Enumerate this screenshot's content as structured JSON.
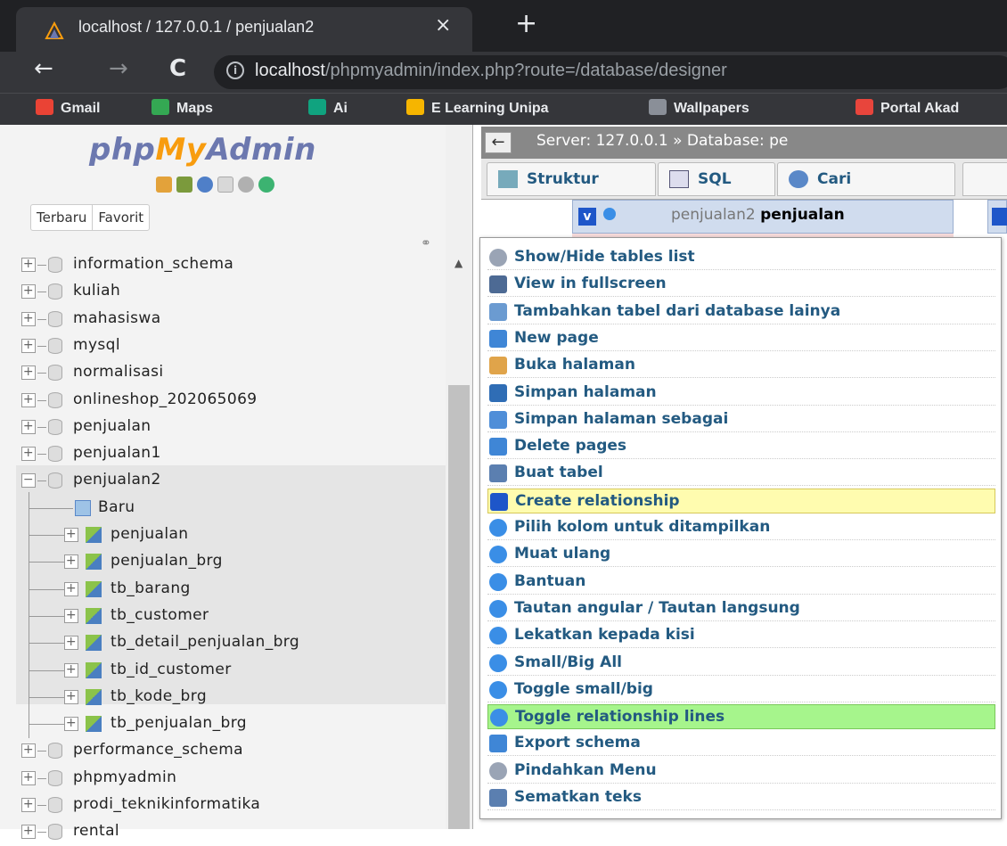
{
  "browser": {
    "tab_title": "localhost / 127.0.0.1 / penjualan2",
    "tab_close": "×",
    "new_tab": "+",
    "nav": {
      "back": "←",
      "forward": "→",
      "reload": "C"
    },
    "info": "i",
    "url_host": "localhost",
    "url_path": "/phpmyadmin/index.php?route=/database/designer",
    "bookmarks": [
      {
        "label": "Gmail",
        "color": "#ea4335"
      },
      {
        "label": "Maps",
        "color": "#34a853"
      },
      {
        "label": "Ai",
        "color": "#10a37f"
      },
      {
        "label": "E Learning Unipa",
        "color": "#f6b500"
      },
      {
        "label": "Wallpapers",
        "color": "#8a8f98"
      },
      {
        "label": "Portal Akad",
        "color": "#e8453c"
      }
    ]
  },
  "nav": {
    "logo_php": "php",
    "logo_my": "My",
    "logo_admin": "Admin",
    "tabs": [
      "Terbaru",
      "Favorit"
    ],
    "link_icon": "⚭",
    "databases_top": [
      "information_schema",
      "kuliah",
      "mahasiswa",
      "mysql",
      "normalisasi",
      "onlineshop_202065069",
      "penjualan",
      "penjualan1"
    ],
    "expanded_db": "penjualan2",
    "new_item": "Baru",
    "tables": [
      "penjualan",
      "penjualan_brg",
      "tb_barang",
      "tb_customer",
      "tb_detail_penjualan_brg",
      "tb_id_customer",
      "tb_kode_brg",
      "tb_penjualan_brg"
    ],
    "databases_bottom": [
      "performance_schema",
      "phpmyadmin",
      "prodi_teknikinformatika",
      "rental"
    ],
    "expander_plus": "+",
    "expander_minus": "−"
  },
  "breadcrumb": {
    "back": "←",
    "text": "Server: 127.0.0.1 » Database: pe"
  },
  "topmenu": {
    "tabs": [
      "Struktur",
      "SQL",
      "Cari"
    ]
  },
  "designer": {
    "table_v": "v",
    "table_db": "penjualan2",
    "table_name": "penjualan"
  },
  "menu": {
    "items": [
      {
        "label": "Show/Hide tables list",
        "state": "",
        "icon": "#9aa4b5"
      },
      {
        "label": "View in fullscreen",
        "state": "",
        "icon": "#4d6a94"
      },
      {
        "label": "Tambahkan tabel dari database lainya",
        "state": "",
        "icon": "#6b9bd1"
      },
      {
        "label": "New page",
        "state": "",
        "icon": "#3f86d6"
      },
      {
        "label": "Buka halaman",
        "state": "",
        "icon": "#e0a44a"
      },
      {
        "label": "Simpan halaman",
        "state": "",
        "icon": "#2f6db5"
      },
      {
        "label": "Simpan halaman sebagai",
        "state": "",
        "icon": "#4f8ed8"
      },
      {
        "label": "Delete pages",
        "state": "",
        "icon": "#3f86d6"
      },
      {
        "label": "Buat tabel",
        "state": "",
        "icon": "#5b7fb0"
      },
      {
        "label": "Create relationship",
        "state": "yellow",
        "icon": "#1e56c9"
      },
      {
        "label": "Pilih kolom untuk ditampilkan",
        "state": "",
        "icon": "#3a8ee6"
      },
      {
        "label": "Muat ulang",
        "state": "",
        "icon": "#3a8ee6"
      },
      {
        "label": "Bantuan",
        "state": "",
        "icon": "#3a8ee6"
      },
      {
        "label": "Tautan angular / Tautan langsung",
        "state": "",
        "icon": "#3a8ee6"
      },
      {
        "label": "Lekatkan kepada kisi",
        "state": "",
        "icon": "#3a8ee6"
      },
      {
        "label": "Small/Big All",
        "state": "",
        "icon": "#3a8ee6"
      },
      {
        "label": "Toggle small/big",
        "state": "",
        "icon": "#3a8ee6"
      },
      {
        "label": "Toggle relationship lines",
        "state": "green",
        "icon": "#3a8ee6"
      },
      {
        "label": "Export schema",
        "state": "",
        "icon": "#3f86d6"
      },
      {
        "label": "Pindahkan Menu",
        "state": "",
        "icon": "#9aa4b5"
      },
      {
        "label": "Sematkan teks",
        "state": "",
        "icon": "#5b7fb0"
      }
    ]
  }
}
